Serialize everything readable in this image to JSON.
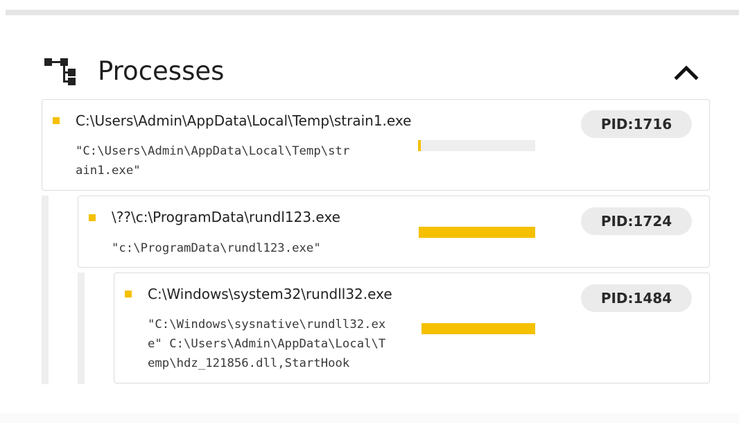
{
  "section": {
    "title": "Processes",
    "icon": "process-tree-icon",
    "collapse_icon": "chevron-up-icon"
  },
  "processes": [
    {
      "path": "C:\\Users\\Admin\\AppData\\Local\\Temp\\strain1.exe",
      "cmd_line1": "\"C:\\Users\\Admin\\AppData\\Local\\Temp\\str",
      "cmd_line2": "ain1.exe\"",
      "pid": "PID:1716"
    },
    {
      "path": "\\??\\c:\\ProgramData\\rundl123.exe",
      "cmd_line1": "\"c:\\ProgramData\\rundl123.exe\"",
      "pid": "PID:1724"
    },
    {
      "path": "C:\\Windows\\system32\\rundll32.exe",
      "cmd_line1": "\"C:\\Windows\\sysnative\\rundll32.ex",
      "cmd_line2": "e\" C:\\Users\\Admin\\AppData\\Local\\T",
      "cmd_line3": "emp\\hdz_121856.dll,StartHook",
      "pid": "PID:1484"
    }
  ],
  "colors": {
    "bullet": "#f5c000",
    "indicator_bar": "#f5c000",
    "indicator_track": "#eeeeee"
  }
}
